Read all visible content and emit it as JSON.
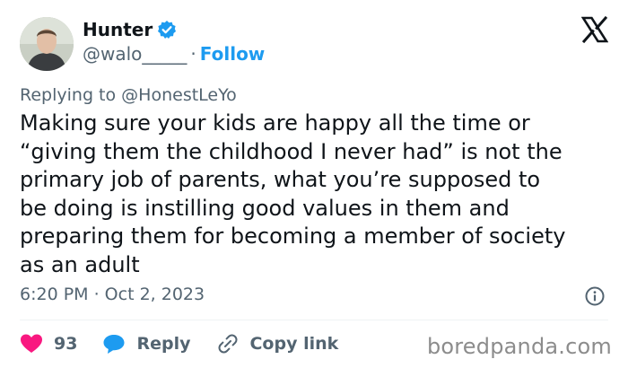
{
  "author": {
    "name": "Hunter",
    "handle": "@walo_____",
    "separator": "·",
    "follow_label": "Follow"
  },
  "reply_context": {
    "prefix": "Replying to",
    "mention": "@HonestLeYo"
  },
  "tweet": {
    "lines": [
      "Making sure your kids are happy all the time or",
      "“giving them the childhood I never had” is not the",
      "primary job of parents, what you’re supposed to",
      "be doing is instilling good values in them and",
      "preparing them for becoming a member of society",
      "as an adult"
    ],
    "timestamp": "6:20 PM · Oct 2, 2023"
  },
  "actions": {
    "like_count": "93",
    "reply_label": "Reply",
    "copy_link_label": "Copy link"
  },
  "watermark": "boredpanda.com",
  "colors": {
    "accent": "#1d9bf0",
    "like": "#f91880",
    "secondary_text": "#536471"
  },
  "icons": [
    "verified-badge-icon",
    "x-logo-icon",
    "info-icon",
    "heart-icon",
    "reply-bubble-icon",
    "link-icon"
  ]
}
